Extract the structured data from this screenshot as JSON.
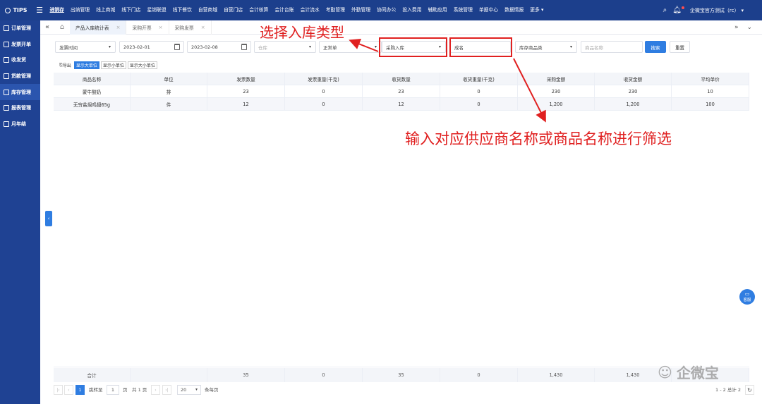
{
  "topnav": {
    "logo": "TIPS",
    "items": [
      "进销存",
      "出纳管理",
      "线上商城",
      "线下门店",
      "星销联盟",
      "线下餐饮",
      "自营商城",
      "自营门店",
      "会计核算",
      "会计台账",
      "会计流水",
      "考勤管理",
      "外勤管理",
      "协同办公",
      "投入费用",
      "辅助应用",
      "系统管理",
      "单据中心",
      "数据情报",
      "更多 ▾"
    ],
    "company": "企微宝官方测试（rc）"
  },
  "sidebar": {
    "items": [
      "订单管理",
      "发票开单",
      "收发货",
      "货款管理",
      "库存管理",
      "报表管理",
      "月年结"
    ]
  },
  "tabs": [
    {
      "label": "产品入库统计表"
    },
    {
      "label": "采购开票"
    },
    {
      "label": "采购发票"
    }
  ],
  "filters": {
    "time_type": "发票时间",
    "date_start": "2023-02-01",
    "date_end": "2023-02-08",
    "warehouse_placeholder": "仓库",
    "status": "正常单",
    "stock_in_type": "采购入库",
    "supplier": "成名",
    "product_category_placeholder": "库存商品类",
    "product_name_placeholder": "商品名称",
    "search_label": "搜索",
    "reset_label": "重置"
  },
  "unit_buttons": {
    "export": "导出",
    "big": "显示大单位",
    "small": "显示小单位",
    "both": "显示大小单位"
  },
  "table": {
    "headers": [
      "商品名称",
      "单位",
      "发票数量",
      "发票重量(千克)",
      "收货数量",
      "收货重量(千克)",
      "采购金额",
      "收货金额",
      "平均单价"
    ],
    "rows": [
      [
        "蒙牛酸奶",
        "排",
        "23",
        "0",
        "23",
        "0",
        "230",
        "230",
        "10"
      ],
      [
        "无穷盐焗鸡翅65g",
        "件",
        "12",
        "0",
        "12",
        "0",
        "1,200",
        "1,200",
        "100"
      ]
    ],
    "totals": [
      "合计",
      "",
      "35",
      "0",
      "35",
      "0",
      "1,430",
      "1,430",
      ""
    ]
  },
  "pager": {
    "current_page": "1",
    "jump_label": "跳转至",
    "jump_value": "1",
    "page_unit": "页",
    "total_pages": "共 1 页",
    "page_size": "20",
    "per_page_label": "条每页",
    "range": "1 - 2 总计 2"
  },
  "annotations": {
    "select_type": "选择入库类型",
    "filter_hint": "输入对应供应商名称或商品名称进行筛选"
  },
  "widgets": {
    "customer_service": "客服",
    "watermark": "企微宝"
  },
  "colors": {
    "nav_bg": "#1c3f8c",
    "accent": "#2f7de1",
    "annotation_red": "#e02020"
  }
}
